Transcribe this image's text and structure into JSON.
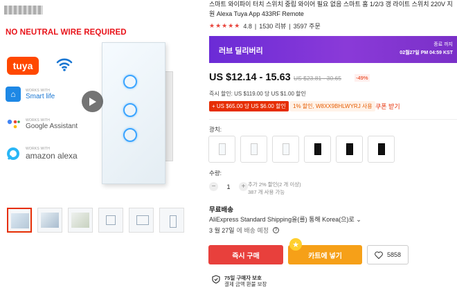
{
  "left": {
    "banner_text": "NO NEUTRAL WIRE REQUIRED",
    "brand_tuya": "tuya",
    "works_with": "WORKS WITH",
    "brands": [
      {
        "icon": "house-icon",
        "name": "Smart life"
      },
      {
        "icon": "google-dots-icon",
        "name": "Google Assistant"
      },
      {
        "icon": "alexa-ring-icon",
        "name": "amazon alexa"
      }
    ],
    "thumbnails": [
      "thumb-1",
      "thumb-2",
      "thumb-3",
      "thumb-4",
      "thumb-5",
      "thumb-6"
    ]
  },
  "product": {
    "title": "스마트 와이파이 터치 스위치 중립 와이어 필요 없음 스마트 홈 1/2/3 갱 라이트 스위치 220V 지원 Alexa Tuya App 433RF Remote",
    "stars": "★★★★★",
    "rating": "4.8",
    "reviews": "1530 리뷰",
    "orders": "3597 주문"
  },
  "promo": {
    "name": "러브 딜리버리",
    "end_label": "종료 까지",
    "end_time": "02월27일 PM 04:59 KST"
  },
  "price": {
    "current": "US $12.14 - 15.63",
    "original": "US $23.81 - 30.65",
    "discount": "-49%",
    "instant": "즉시 할인: US $119.00 당 US $1.00 할인",
    "coupon_1": "+ US $65.00 당 US $6.00 할인",
    "coupon_2": "1% 할인, W8XX9BHLWYRJ 사용",
    "get_coupon": "쿠폰 받기"
  },
  "options": {
    "color_label": "광치:",
    "colors": [
      "white-1",
      "white-2",
      "white-3",
      "black-1",
      "black-2",
      "black-3"
    ],
    "quantity_label": "수량:",
    "quantity": "1",
    "qty_note_1": "추가 2% 할인(2 개 이상)",
    "qty_note_2": "387 개 사용 가능"
  },
  "shipping": {
    "heading": "무료배송",
    "line": "AliExpress Standard Shipping을(를) 통해 Korea(으)로",
    "date": "3 월 27일",
    "date_suffix": "에 배송 예정"
  },
  "actions": {
    "buy": "즉시 구매",
    "cart": "카트에 넣기",
    "wishlist_count": "5858"
  },
  "guarantee": {
    "title": "75일 구매자 보호",
    "subtitle": "결제 금액 환불 보장"
  },
  "colors": {
    "accent": "#e62e04",
    "promo": "#7a30c8",
    "cart": "#f6a018",
    "buy": "#e8403c"
  }
}
